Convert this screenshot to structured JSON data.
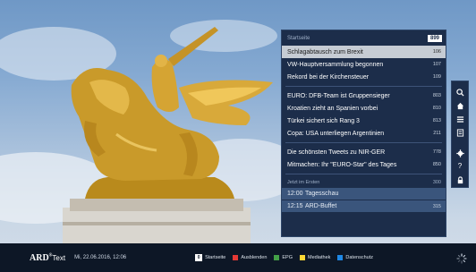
{
  "teletext": {
    "header_label": "Startseite",
    "page_number": "899",
    "news": [
      {
        "title": "Schlagabtausch zum Brexit",
        "page": "106"
      },
      {
        "title": "VW-Hauptversammlung begonnen",
        "page": "107"
      },
      {
        "title": "Rekord bei der Kirchensteuer",
        "page": "109"
      }
    ],
    "sports": [
      {
        "title": "EURO: DFB-Team ist Gruppensieger",
        "page": "803"
      },
      {
        "title": "Kroatien zieht an Spanien vorbei",
        "page": "810"
      },
      {
        "title": "Türkei sichert sich Rang 3",
        "page": "813"
      },
      {
        "title": "Copa: USA unterliegen Argentinien",
        "page": "211"
      }
    ],
    "misc": [
      {
        "title": "Die schönsten Tweets zu NIR-GER",
        "page": "778"
      },
      {
        "title": "Mitmachen: Ihr \"EURO-Star\" des Tages",
        "page": "850"
      }
    ],
    "schedule_label": "Jetzt im Ersten",
    "schedule_page": "300",
    "schedule": [
      {
        "time": "12:00",
        "show": "Tagesschau",
        "page": ""
      },
      {
        "time": "12:15",
        "show": "ARD-Buffet",
        "page": "315"
      }
    ]
  },
  "side_icons": [
    "search-icon",
    "home-icon",
    "list-icon",
    "index-icon",
    "gear-icon",
    "help-icon",
    "lock-icon"
  ],
  "bottom_bar": {
    "logo": "ARD",
    "logo_sup": "®",
    "logo_suffix": "Text",
    "datetime": "Mi, 22.06.2016, 12:06",
    "buttons": [
      {
        "label": "Startseite",
        "color": "#ffffff",
        "key": "0"
      },
      {
        "label": "Ausblenden",
        "color": "#e53935"
      },
      {
        "label": "EPG",
        "color": "#43a047"
      },
      {
        "label": "Mediathek",
        "color": "#fdd835"
      },
      {
        "label": "Datenschutz",
        "color": "#1e88e5"
      }
    ]
  }
}
